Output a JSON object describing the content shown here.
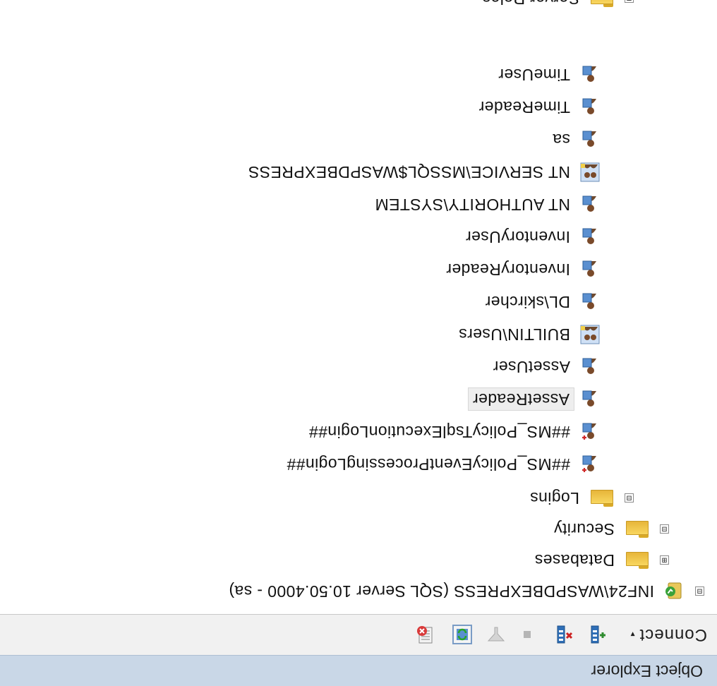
{
  "panel": {
    "title": "Object Explorer"
  },
  "toolbar": {
    "connect_label": "Connect",
    "connect_arrow": "▾",
    "buttons": [
      "connect-db-icon",
      "disconnect-db-icon",
      "stop-icon",
      "filter-icon",
      "refresh-icon",
      "script-icon"
    ]
  },
  "tree": {
    "server": {
      "label": "INF24\\WASPDBEXPRESS (SQL Server 10.50.4000 - sa)",
      "expander": "⊟"
    },
    "databases": {
      "label": "Databases",
      "expander": "⊞"
    },
    "security": {
      "label": "Security",
      "expander": "⊟"
    },
    "logins": {
      "label": "Logins",
      "expander": "⊟",
      "items": [
        {
          "label": "##MS_PolicyEventProcessingLogin##",
          "icon": "login-disabled-icon"
        },
        {
          "label": "##MS_PolicyTsqlExecutionLogin##",
          "icon": "login-disabled-icon"
        },
        {
          "label": "AssetReader",
          "icon": "login-icon",
          "selected": true
        },
        {
          "label": "AssetUser",
          "icon": "login-icon"
        },
        {
          "label": "BUILTIN\\Users",
          "icon": "group-login-icon"
        },
        {
          "label": "DL\\skircher",
          "icon": "login-icon"
        },
        {
          "label": "InventoryReader",
          "icon": "login-icon"
        },
        {
          "label": "InventoryUser",
          "icon": "login-icon"
        },
        {
          "label": "NT AUTHORITY\\SYSTEM",
          "icon": "login-icon"
        },
        {
          "label": "NT SERVICE\\MSSQL$WASPDBEXPRESS",
          "icon": "group-login-icon"
        },
        {
          "label": "sa",
          "icon": "login-icon"
        },
        {
          "label": "TimeReader",
          "icon": "login-icon"
        },
        {
          "label": "TimeUser",
          "icon": "login-icon"
        }
      ]
    },
    "server_roles": {
      "label": "Server Roles",
      "expander": "⊞"
    }
  }
}
